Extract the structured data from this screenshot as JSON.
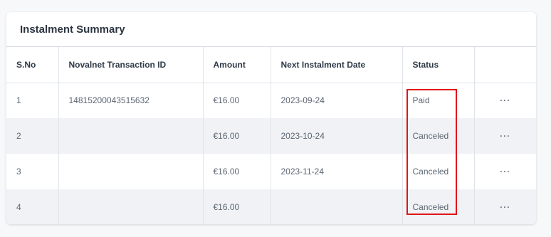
{
  "panel": {
    "title": "Instalment Summary"
  },
  "table": {
    "headers": [
      "S.No",
      "Novalnet Transaction ID",
      "Amount",
      "Next Instalment Date",
      "Status",
      ""
    ],
    "rows": [
      {
        "sno": "1",
        "tid": "14815200043515632",
        "amount": "€16.00",
        "date": "2023-09-24",
        "status": "Paid",
        "action": "···"
      },
      {
        "sno": "2",
        "tid": "",
        "amount": "€16.00",
        "date": "2023-10-24",
        "status": "Canceled",
        "action": "···"
      },
      {
        "sno": "3",
        "tid": "",
        "amount": "€16.00",
        "date": "2023-11-24",
        "status": "Canceled",
        "action": "···"
      },
      {
        "sno": "4",
        "tid": "",
        "amount": "€16.00",
        "date": "",
        "status": "Canceled",
        "action": "···"
      }
    ]
  },
  "annotation": {
    "highlight_color": "#e0151b"
  }
}
